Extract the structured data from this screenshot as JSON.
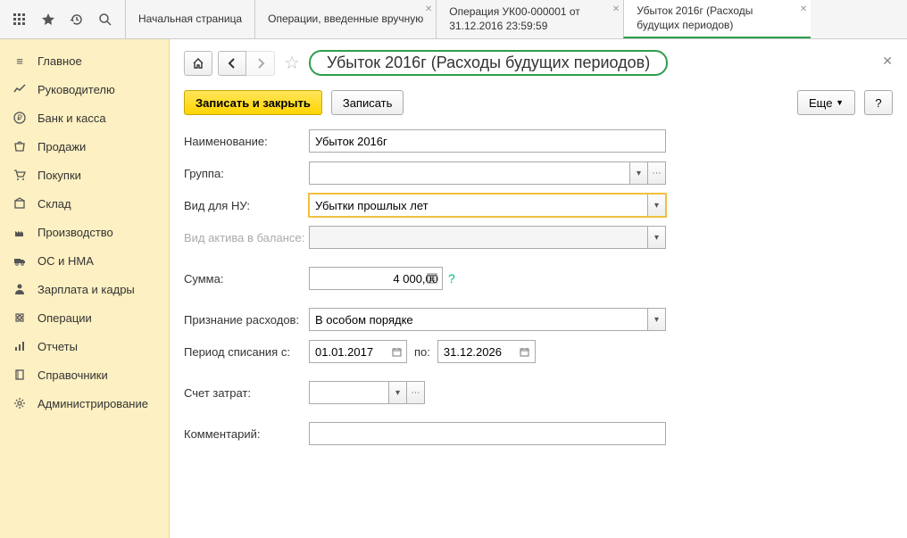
{
  "toolbar": {
    "tabs": [
      {
        "label": "Начальная страница"
      },
      {
        "label": "Операции, введенные вручную"
      },
      {
        "label": "Операция УК00-000001 от 31.12.2016 23:59:59"
      },
      {
        "label": "Убыток 2016г (Расходы будущих периодов)"
      }
    ]
  },
  "sidebar": {
    "items": [
      {
        "label": "Главное"
      },
      {
        "label": "Руководителю"
      },
      {
        "label": "Банк и касса"
      },
      {
        "label": "Продажи"
      },
      {
        "label": "Покупки"
      },
      {
        "label": "Склад"
      },
      {
        "label": "Производство"
      },
      {
        "label": "ОС и НМА"
      },
      {
        "label": "Зарплата и кадры"
      },
      {
        "label": "Операции"
      },
      {
        "label": "Отчеты"
      },
      {
        "label": "Справочники"
      },
      {
        "label": "Администрирование"
      }
    ]
  },
  "page": {
    "title": "Убыток 2016г (Расходы будущих периодов)",
    "actions": {
      "save_close": "Записать и закрыть",
      "save": "Записать",
      "more": "Еще",
      "help": "?"
    },
    "form": {
      "name_label": "Наименование:",
      "name_value": "Убыток 2016г",
      "group_label": "Группа:",
      "group_value": "",
      "nu_type_label": "Вид для НУ:",
      "nu_type_value": "Убытки прошлых лет",
      "asset_kind_label": "Вид актива в балансе:",
      "asset_kind_value": "",
      "sum_label": "Сумма:",
      "sum_value": "4 000,00",
      "recognition_label": "Признание расходов:",
      "recognition_value": "В особом порядке",
      "period_from_label": "Период списания с:",
      "period_from_value": "01.01.2017",
      "period_to_label": "по:",
      "period_to_value": "31.12.2026",
      "cost_account_label": "Счет затрат:",
      "cost_account_value": "",
      "comment_label": "Комментарий:",
      "comment_value": ""
    }
  }
}
